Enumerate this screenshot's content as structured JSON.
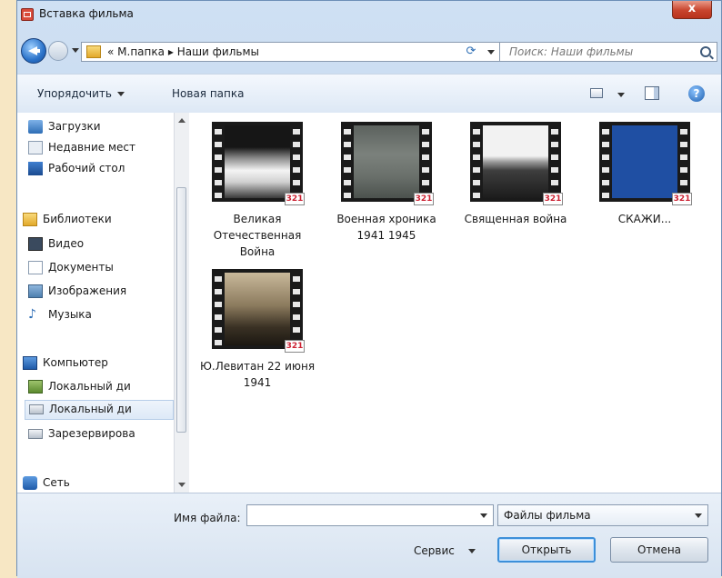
{
  "window": {
    "title": "Вставка фильма",
    "close_label": "x"
  },
  "nav": {
    "path_prefix": "«",
    "path": [
      "М.папка",
      "Наши фильмы"
    ],
    "path_separator": "▸",
    "search_placeholder": "Поиск: Наши фильмы"
  },
  "toolbar": {
    "organize": "Упорядочить",
    "new_folder": "Новая папка",
    "help": "?"
  },
  "sidebar": {
    "items": [
      {
        "label": "Загрузки",
        "icon": "downloads-icon"
      },
      {
        "label": "Недавние мест",
        "icon": "recent-places-icon"
      },
      {
        "label": "Рабочий стол",
        "icon": "desktop-icon"
      },
      {
        "label": "Библиотеки",
        "icon": "libraries-icon"
      },
      {
        "label": "Видео",
        "icon": "video-icon"
      },
      {
        "label": "Документы",
        "icon": "documents-icon"
      },
      {
        "label": "Изображения",
        "icon": "pictures-icon"
      },
      {
        "label": "Музыка",
        "icon": "music-icon"
      },
      {
        "label": "Компьютер",
        "icon": "computer-icon"
      },
      {
        "label": "Локальный ди",
        "icon": "local-disk-icon"
      },
      {
        "label": "Локальный ди",
        "icon": "local-disk-icon",
        "selected": true
      },
      {
        "label": "Зарезервирова",
        "icon": "reserved-disk-icon"
      },
      {
        "label": "Сеть",
        "icon": "network-icon"
      }
    ]
  },
  "files": [
    {
      "label": "Великая Отечественная Война",
      "badge": "321"
    },
    {
      "label": "Военная хроника 1941 1945",
      "badge": "321"
    },
    {
      "label": "Священная война",
      "badge": "321"
    },
    {
      "label": "СКАЖИ...",
      "badge": "321"
    },
    {
      "label": "Ю.Левитан 22 июня 1941",
      "badge": "321"
    }
  ],
  "footer": {
    "filename_label": "Имя файла:",
    "filename_value": "",
    "filetype": "Файлы фильма",
    "tools": "Сервис",
    "open": "Открыть",
    "cancel": "Отмена"
  },
  "colors": {
    "accent": "#3c8fd9",
    "close": "#c8442d",
    "window_frame": "#b9d1ec"
  }
}
